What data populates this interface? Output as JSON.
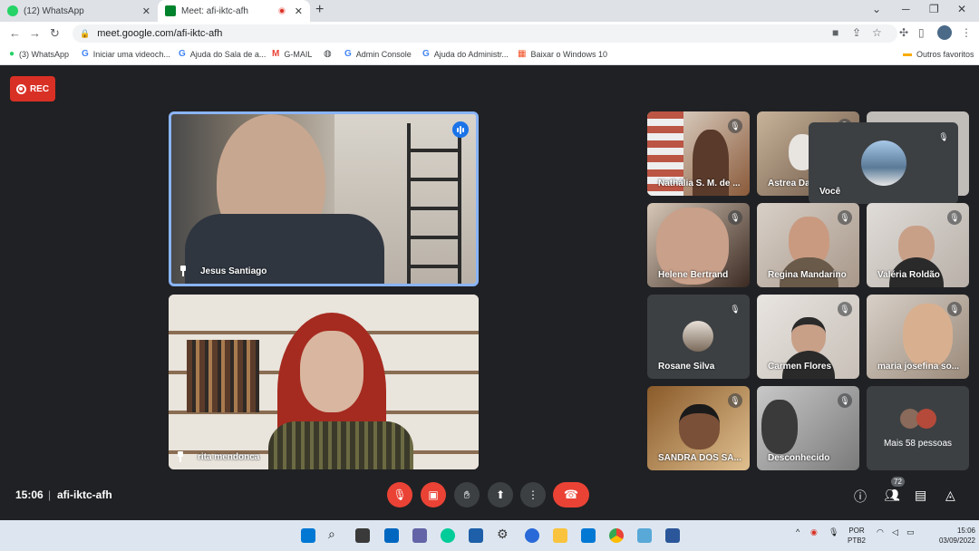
{
  "tabs": [
    {
      "title": "(12) WhatsApp",
      "close": "✕",
      "active": false
    },
    {
      "title": "Meet: afi-iktc-afh",
      "close": "✕",
      "active": true
    }
  ],
  "window_controls": {
    "chevron": "⌄",
    "minimize": "─",
    "restore": "❐",
    "close": "✕"
  },
  "new_tab": "+",
  "address": {
    "url": "meet.google.com/afi-iktc-afh"
  },
  "bookmarks": [
    {
      "label": "(3) WhatsApp",
      "icon": "whatsapp-icon"
    },
    {
      "label": "Iniciar uma videoch...",
      "icon": "google-icon"
    },
    {
      "label": "Ajuda do Sala de a...",
      "icon": "google-icon"
    },
    {
      "label": "G-MAIL",
      "icon": "gmail-icon"
    },
    {
      "label": "",
      "icon": "globe-icon"
    },
    {
      "label": "Admin Console",
      "icon": "google-icon"
    },
    {
      "label": "Ajuda do Administr...",
      "icon": "google-icon"
    },
    {
      "label": "Baixar o Windows 10",
      "icon": "windows-icon"
    },
    {
      "label": "Outros favoritos",
      "icon": "folder-icon"
    }
  ],
  "meet": {
    "rec_label": "REC",
    "main_tiles": [
      {
        "name": "Jesus Santiago",
        "speaking": true
      },
      {
        "name": "rita mendonca",
        "speaking": false
      }
    ],
    "grid_tiles": [
      {
        "name": "Nathália S. M. de ...",
        "muted": true
      },
      {
        "name": "Astrea Da",
        "muted": true
      },
      {
        "name": "Você",
        "muted": true,
        "self": true
      },
      {
        "name": "Helene Bertrand",
        "muted": true
      },
      {
        "name": "Regina Mandarino",
        "muted": true
      },
      {
        "name": "Valéria Roldão",
        "muted": true
      },
      {
        "name": "Rosane Silva",
        "muted": true
      },
      {
        "name": "Carmen Flores",
        "muted": true
      },
      {
        "name": "maria josefina so...",
        "muted": true
      },
      {
        "name": "SANDRA DOS SA...",
        "muted": true
      },
      {
        "name": "Desconhecido",
        "muted": true
      }
    ],
    "more_people": "Mais 58 pessoas",
    "participants_count": "72"
  },
  "bottom": {
    "time": "15:06",
    "separator": "|",
    "meeting_code": "afi-iktc-afh"
  },
  "taskbar": {
    "lang_line1": "POR",
    "lang_line2": "PTB2",
    "time": "15:06",
    "date": "03/09/2022"
  }
}
